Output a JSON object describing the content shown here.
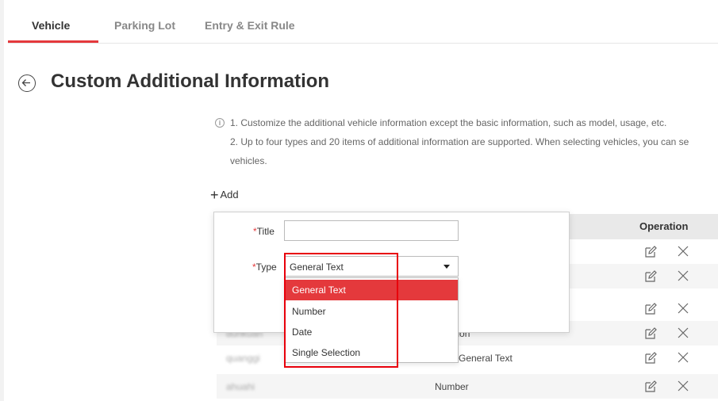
{
  "tabs": [
    {
      "label": "Vehicle",
      "active": true
    },
    {
      "label": "Parking Lot",
      "active": false
    },
    {
      "label": "Entry & Exit Rule",
      "active": false
    }
  ],
  "header": {
    "back_icon": "back-circle-arrow-icon",
    "title": "Custom Additional Information"
  },
  "notes": {
    "line1": "1. Customize the additional vehicle information except the basic information, such as model, usage, etc.",
    "line2": "2. Up to four types and 20 items of additional information are supported. When selecting vehicles, you can se",
    "line3": "vehicles."
  },
  "add_label": "Add",
  "table": {
    "operation_header": "Operation",
    "rows": [
      {
        "name": "",
        "type": ""
      },
      {
        "name": "",
        "type": ""
      },
      {
        "name": "",
        "type": ""
      },
      {
        "name": "dunkuan",
        "type": "Selection"
      },
      {
        "name": "quanggi",
        "type": "General Text"
      },
      {
        "name": "ahuahi",
        "type": "Number"
      }
    ]
  },
  "form": {
    "title_label": "Title",
    "title_value": "",
    "type_label": "Type",
    "type_value": "General Text",
    "required_mark": "*"
  },
  "dropdown": {
    "options": [
      "General Text",
      "Number",
      "Date",
      "Single Selection"
    ],
    "selected_index": 0
  },
  "colors": {
    "accent": "#e4393c",
    "highlight_border": "#e8000b"
  }
}
